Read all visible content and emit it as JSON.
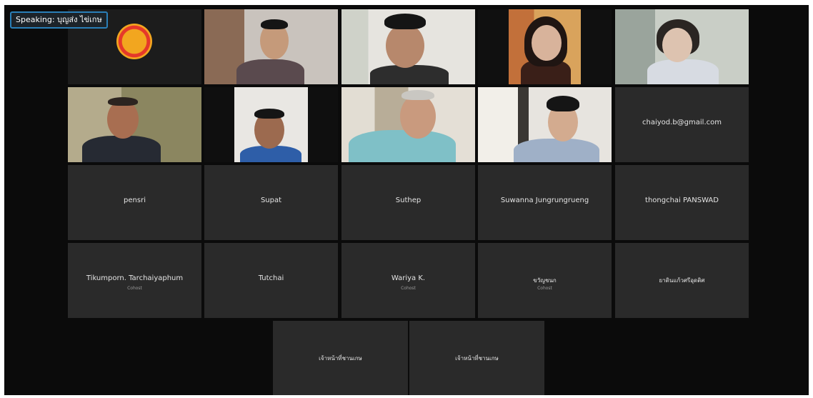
{
  "speaking": "Speaking: บุญส่ง ไข่เกษ",
  "tiles": {
    "r1": [
      "logo",
      "video1",
      "video2",
      "video3",
      "video4"
    ],
    "r2": [
      "video5",
      "video6",
      "video7",
      "video8"
    ],
    "chaiyod": "chaiyod.b@gmail.com",
    "pensri": "pensri",
    "supat": "Supat",
    "suthep": "Suthep",
    "suwanna": "Suwanna Jungrungrueng",
    "thongchai": "thongchai PANSWAD",
    "tikumporn": {
      "name": "Tikumporn. Tarchaiyaphum",
      "role": "Cohost"
    },
    "tutchai": "Tutchai",
    "wariya": {
      "name": "Wariya K.",
      "role": "Cohost"
    },
    "thai1": {
      "name": "ขวัญชนก",
      "role": "Cohost"
    },
    "thai2": "ยาดินแก้วศรีอุดติศ",
    "staff1": "เจ้าหน้าที่ชานเกษ",
    "staff2": "เจ้าหน้าที่ชานเกษ"
  },
  "colors": {
    "background": "#0b0b0b",
    "tile": "#2a2a2a",
    "speaking_border": "#2a7fb8",
    "logo_orange": "#f2a61f",
    "logo_red": "#e5382a"
  },
  "icons": [
    "parliament-emblem-icon"
  ]
}
